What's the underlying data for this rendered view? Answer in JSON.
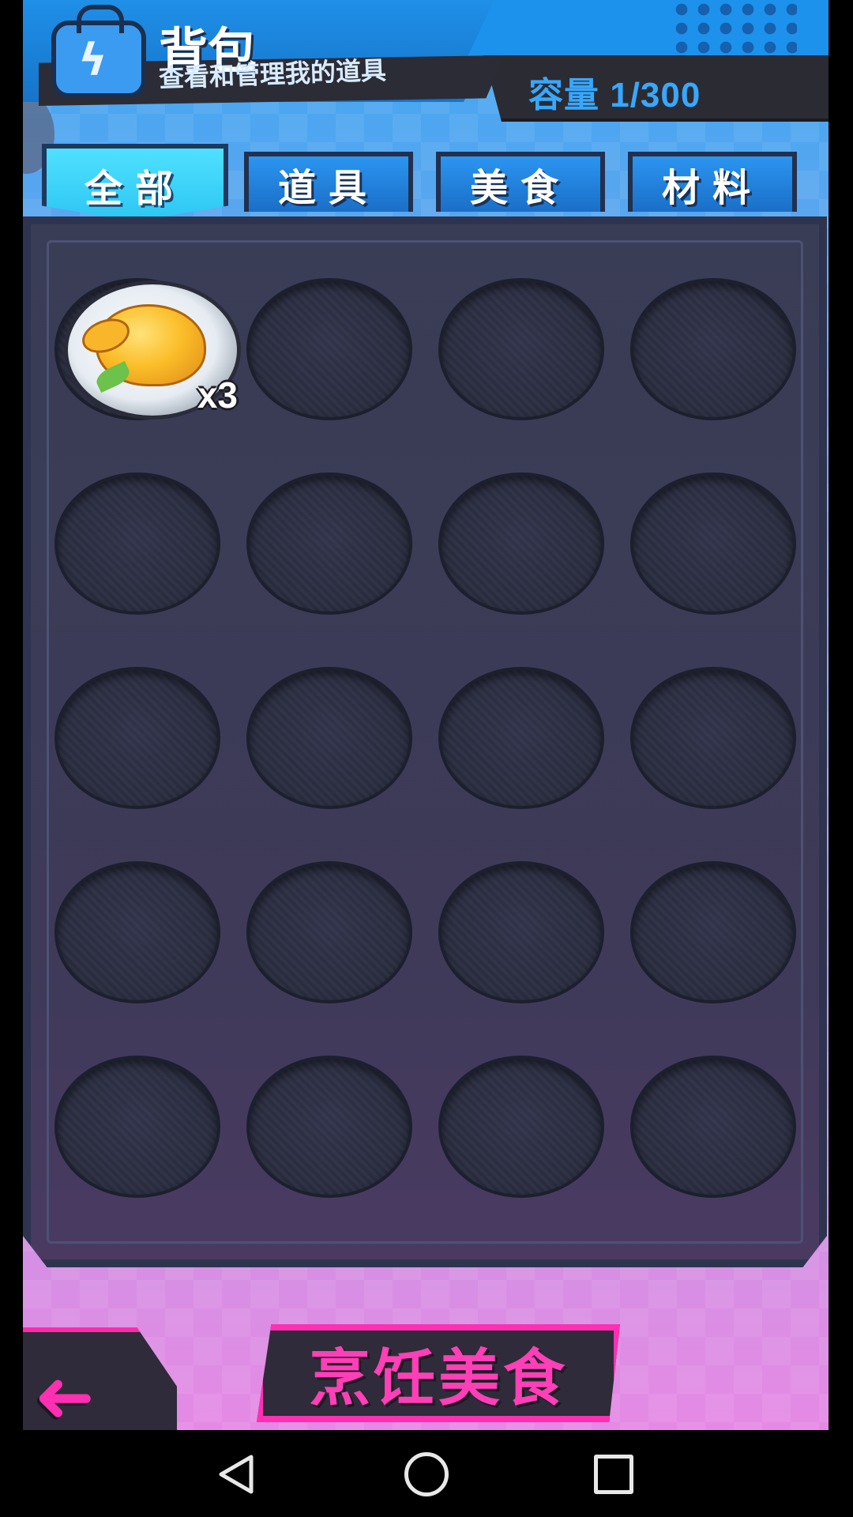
{
  "header": {
    "title": "背包",
    "subtitle": "查看和管理我的道具",
    "capacity": "容量 1/300"
  },
  "tabs": [
    {
      "label": "全部",
      "active": true
    },
    {
      "label": "道具",
      "active": false
    },
    {
      "label": "美食",
      "active": false
    },
    {
      "label": "材料",
      "active": false
    }
  ],
  "inventory": {
    "items": [
      {
        "name": "roast-chicken",
        "quantity_label": "x3"
      }
    ]
  },
  "footer": {
    "cook_label": "烹饪美食"
  },
  "icons": {
    "back": "back-arrow-icon",
    "bag": "backpack-icon"
  },
  "colors": {
    "accent_pink": "#ff2fb3",
    "tab_active": "#2cc6f2",
    "tab_inactive": "#1a6fc8"
  }
}
